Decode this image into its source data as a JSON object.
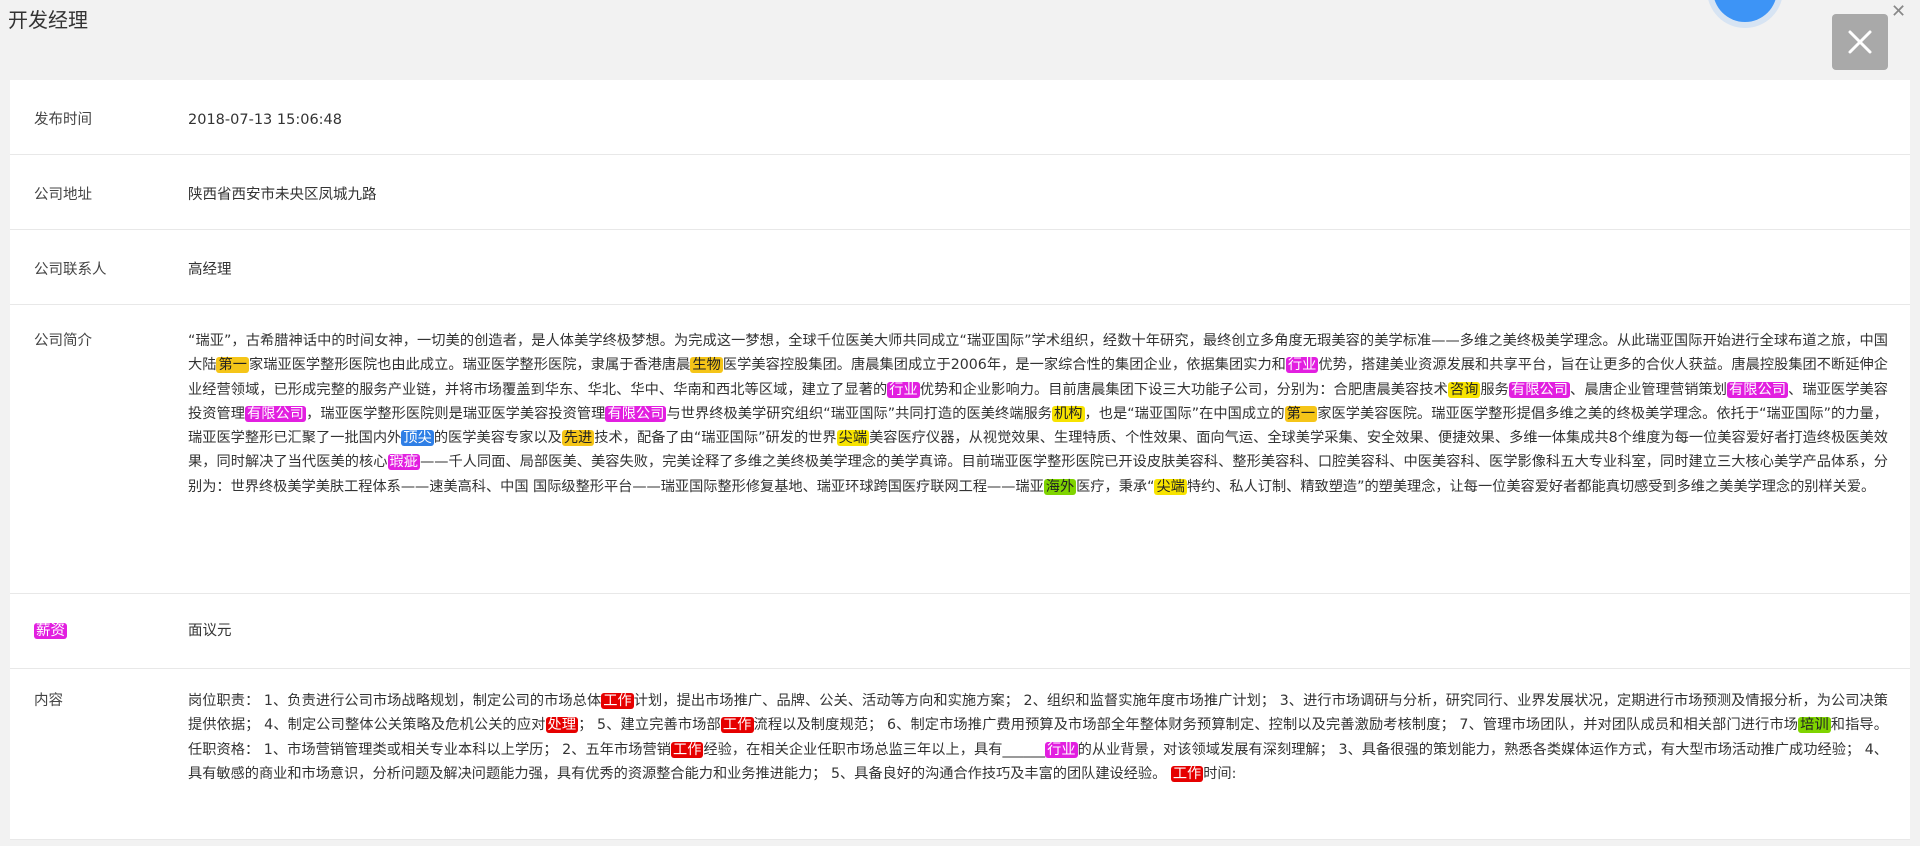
{
  "modal": {
    "title": "开发经理"
  },
  "fields": {
    "publish_time": {
      "label": "发布时间",
      "value": "2018-07-13 15:06:48"
    },
    "address": {
      "label": "公司地址",
      "value": "陕西省西安市未央区凤城九路"
    },
    "contact": {
      "label": "公司联系人",
      "value": "高经理"
    },
    "intro": {
      "label": "公司简介"
    },
    "salary": {
      "label": "薪资",
      "value": "面议元"
    },
    "content": {
      "label": "内容"
    }
  },
  "intro_segments": [
    {
      "t": "“瑞亚”，古希腊神话中的时间女神，一切美的创造者，是人体美学终极梦想。为完成这一梦想，全球千位医美大师共同成立“瑞亚国际”学术组织，经数十年研究，最终创立多角度无瑕美容的美学标准——多维之美终极美学理念。从此瑞亚国际开始进行全球布道之旅，中国大陆"
    },
    {
      "t": "第一",
      "c": "orange"
    },
    {
      "t": "家瑞亚医学整形医院也由此成立。瑞亚医学整形医院，隶属于香港唐晨"
    },
    {
      "t": "生物",
      "c": "orange"
    },
    {
      "t": "医学美容控股集团。唐晨集团成立于2006年，是一家综合性的集团企业，依据集团实力和"
    },
    {
      "t": "行业",
      "c": "magenta"
    },
    {
      "t": "优势，搭建美业资源发展和共享平台，旨在让更多的合伙人获益。唐晨控股集团不断延伸企业经营领域，已形成完整的服务产业链，并将市场覆盖到华东、华北、华中、华南和西北等区域，建立了显著的"
    },
    {
      "t": "行业",
      "c": "magenta"
    },
    {
      "t": "优势和企业影响力。目前唐晨集团下设三大功能子公司，分别为：合肥唐晨美容技术"
    },
    {
      "t": "咨询",
      "c": "yellow"
    },
    {
      "t": "服务"
    },
    {
      "t": "有限公司",
      "c": "magenta"
    },
    {
      "t": "、晨唐企业管理营销策划"
    },
    {
      "t": "有限公司",
      "c": "magenta"
    },
    {
      "t": "、瑞亚医学美容投资管理"
    },
    {
      "t": "有限公司",
      "c": "magenta"
    },
    {
      "t": "，瑞亚医学整形医院则是瑞亚医学美容投资管理"
    },
    {
      "t": "有限公司",
      "c": "magenta"
    },
    {
      "t": "与世界终极美学研究组织“瑞亚国际”共同打造的医美终端服务"
    },
    {
      "t": "机构",
      "c": "yellow"
    },
    {
      "t": "，也是“瑞亚国际”在中国成立的"
    },
    {
      "t": "第一",
      "c": "orange"
    },
    {
      "t": "家医学美容医院。瑞亚医学整形提倡多维之美的终极美学理念。依托于“瑞亚国际”的力量，瑞亚医学整形已汇聚了一批国内外"
    },
    {
      "t": "顶尖",
      "c": "blue"
    },
    {
      "t": "的医学美容专家以及"
    },
    {
      "t": "先进",
      "c": "orange"
    },
    {
      "t": "技术，配备了由“瑞亚国际”研发的世界"
    },
    {
      "t": "尖端",
      "c": "yellow"
    },
    {
      "t": "美容医疗仪器，从视觉效果、生理特质、个性效果、面向气运、全球美学采集、安全效果、便捷效果、多维一体集成共8个维度为每一位美容爱好者打造终极医美效果，同时解决了当代医美的核心"
    },
    {
      "t": "瑕疵",
      "c": "magenta"
    },
    {
      "t": "——千人同面、局部医美、美容失败，完美诠释了多维之美终极美学理念的美学真谛。目前瑞亚医学整形医院已开设皮肤美容科、整形美容科、口腔美容科、中医美容科、医学影像科五大专业科室，同时建立三大核心美学产品体系，分别为：世界终极美学美肤工程体系——速美高科、中国 国际级整形平台——瑞亚国际整形修复基地、瑞亚环球跨国医疗联网工程——瑞亚"
    },
    {
      "t": "海外",
      "c": "green"
    },
    {
      "t": "医疗，秉承“"
    },
    {
      "t": "尖端",
      "c": "yellow"
    },
    {
      "t": "特约、私人订制、精致塑造”的塑美理念，让每一位美容爱好者都能真切感受到多维之美美学理念的别样关爱。"
    }
  ],
  "content_segments": [
    {
      "t": "岗位职责： 1、负责进行公司市场战略规划，制定公司的市场总体"
    },
    {
      "t": "工作",
      "c": "red"
    },
    {
      "t": "计划，提出市场推广、品牌、公关、活动等方向和实施方案； 2、组织和监督实施年度市场推广计划； 3、进行市场调研与分析，研究同行、业界发展状况，定期进行市场预测及情报分析，为公司决策提供依据； 4、制定公司整体公关策略及危机公关的应对"
    },
    {
      "t": "处理",
      "c": "red"
    },
    {
      "t": "； 5、建立完善市场部"
    },
    {
      "t": "工作",
      "c": "red"
    },
    {
      "t": "流程以及制度规范； 6、制定市场推广费用预算及市场部全年整体财务预算制定、控制以及完善激励考核制度； 7、管理市场团队，并对团队成员和相关部门进行市场"
    },
    {
      "t": "培训",
      "c": "green"
    },
    {
      "t": "和指导。 任职资格： 1、市场营销管理类或相关专业本科以上学历； 2、五年市场营销"
    },
    {
      "t": "工作",
      "c": "red"
    },
    {
      "t": "经验，在相关企业任职市场总监三年以上，具有______"
    },
    {
      "t": "行业",
      "c": "magenta"
    },
    {
      "t": "的从业背景，对该领域发展有深刻理解； 3、具备很强的策划能力，熟悉各类媒体运作方式，有大型市场活动推广成功经验； 4、具有敏感的商业和市场意识，分析问题及解决问题能力强，具有优秀的资源整合能力和业务推进能力； 5、具备良好的沟通合作技巧及丰富的团队建设经验。 "
    },
    {
      "t": "工作",
      "c": "red"
    },
    {
      "t": "时间:"
    }
  ],
  "colors": {
    "yellow": "#f7e300",
    "orange": "#f5c518",
    "magenta": "#e21fe0",
    "red": "#e60000",
    "blue": "#2f7fe6",
    "green": "#7fd400"
  },
  "icons": {
    "close": "close-icon",
    "corner_close": "close-icon"
  }
}
